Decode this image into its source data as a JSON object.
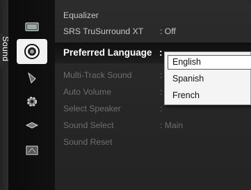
{
  "sidebar": {
    "tab_label": "Sound",
    "icons": [
      "picture-icon",
      "sound-icon",
      "channel-icon",
      "setup-icon",
      "input-icon",
      "application-icon"
    ]
  },
  "menu": {
    "items": [
      {
        "label": "Equalizer",
        "value": ""
      },
      {
        "label": "SRS TruSurround XT",
        "value": ": Off"
      },
      {
        "label": "Preferred Language",
        "value": ":"
      },
      {
        "label": "Multi-Track Sound",
        "value": ":"
      },
      {
        "label": "Auto Volume",
        "value": ":"
      },
      {
        "label": "Select Speaker",
        "value": ":"
      },
      {
        "label": "Sound Select",
        "value": ": Main"
      },
      {
        "label": "Sound Reset",
        "value": ""
      }
    ]
  },
  "dropdown": {
    "options": [
      "English",
      "Spanish",
      "French"
    ],
    "selected": "English"
  }
}
